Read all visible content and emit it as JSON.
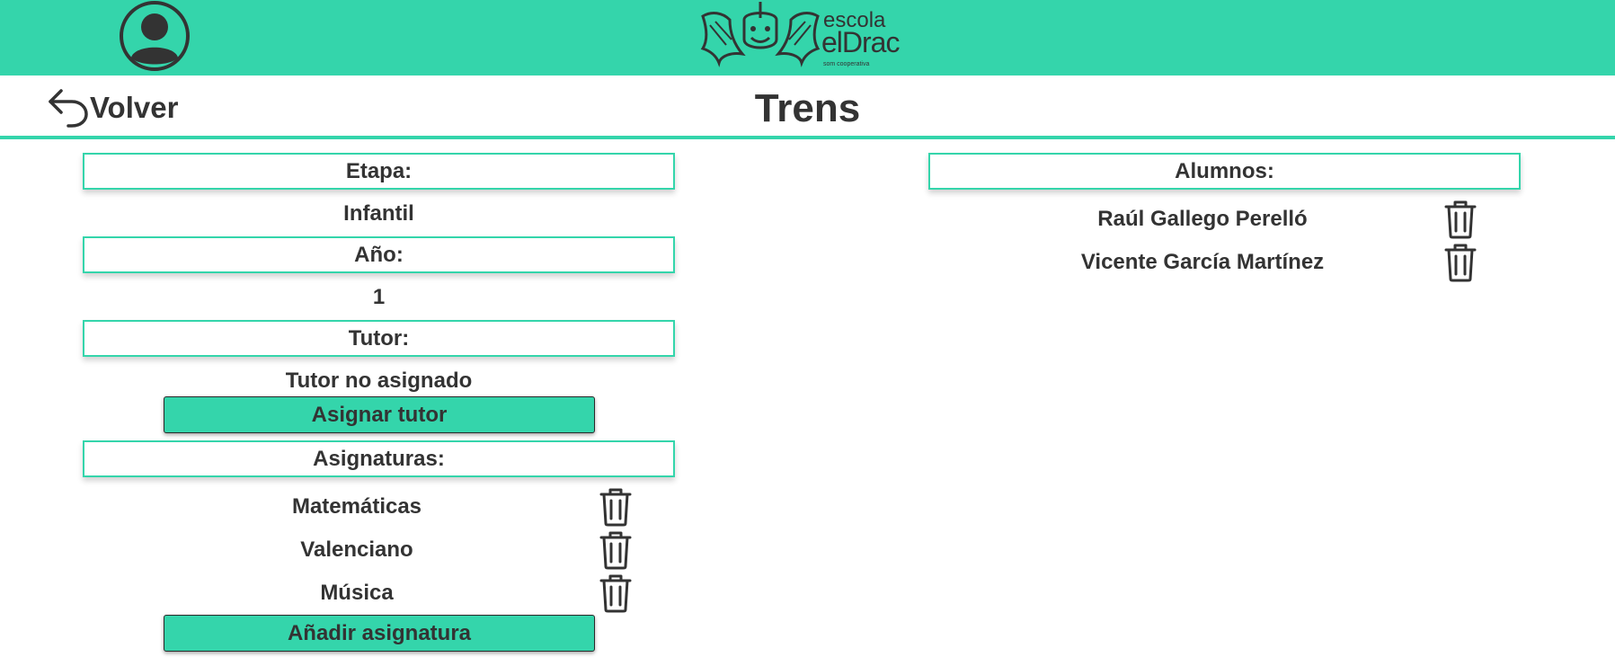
{
  "header": {
    "logo": {
      "line1": "escola",
      "line2": "elDrac",
      "tagline": "som cooperativa"
    },
    "avatar_icon": "user-avatar-icon",
    "brand_color": "#34d5ab"
  },
  "nav": {
    "back_label": "Volver",
    "back_icon": "undo-arrow-icon"
  },
  "page": {
    "title": "Trens"
  },
  "details": {
    "stage_header": "Etapa:",
    "stage_value": "Infantil",
    "year_header": "Año:",
    "year_value": "1",
    "tutor_header": "Tutor:",
    "tutor_value": "Tutor no asignado",
    "assign_tutor_button": "Asignar tutor",
    "subjects_header": "Asignaturas:",
    "subjects": [
      {
        "name": "Matemáticas",
        "delete_icon": "trash-icon"
      },
      {
        "name": "Valenciano",
        "delete_icon": "trash-icon"
      },
      {
        "name": "Música",
        "delete_icon": "trash-icon"
      }
    ],
    "add_subject_button": "Añadir asignatura"
  },
  "students": {
    "header": "Alumnos:",
    "items": [
      {
        "name": "Raúl Gallego Perelló",
        "delete_icon": "trash-icon"
      },
      {
        "name": "Vicente García Martínez",
        "delete_icon": "trash-icon"
      }
    ]
  }
}
